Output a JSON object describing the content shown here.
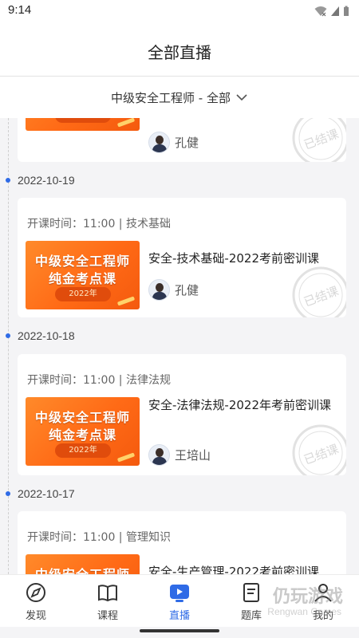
{
  "status_bar": {
    "time": "9:14"
  },
  "header": {
    "title": "全部直播"
  },
  "filter": {
    "label": "中级安全工程师 - 全部"
  },
  "thumbnail": {
    "line1": "中级安全工程师",
    "line2": "纯金考点课",
    "year": "2022年"
  },
  "stamp_text": "已结课",
  "sections": [
    {
      "date": "",
      "time_label": "",
      "course_title": "",
      "teacher": "孔健"
    },
    {
      "date": "2022-10-19",
      "time_label": "开课时间：11:00 | 技术基础",
      "course_title": "安全-技术基础-2022考前密训课",
      "teacher": "孔健"
    },
    {
      "date": "2022-10-18",
      "time_label": "开课时间：11:00 | 法律法规",
      "course_title": "安全-法律法规-2022年考前密训课",
      "teacher": "王培山"
    },
    {
      "date": "2022-10-17",
      "time_label": "开课时间：11:00 | 管理知识",
      "course_title": "安全-生产管理-2022考前密训课",
      "teacher": ""
    }
  ],
  "tabs": [
    {
      "label": "发现",
      "icon": "discover-icon"
    },
    {
      "label": "课程",
      "icon": "book-icon"
    },
    {
      "label": "直播",
      "icon": "live-icon"
    },
    {
      "label": "题库",
      "icon": "question-bank-icon"
    },
    {
      "label": "我的",
      "icon": "profile-icon"
    }
  ],
  "active_tab": "直播",
  "watermark": {
    "line1": "仍玩游戏",
    "line2": "Rengwan Games"
  },
  "colors": {
    "accent": "#2f6be6",
    "thumb_orange": "#ff7a20",
    "background": "#f4f4f6"
  }
}
